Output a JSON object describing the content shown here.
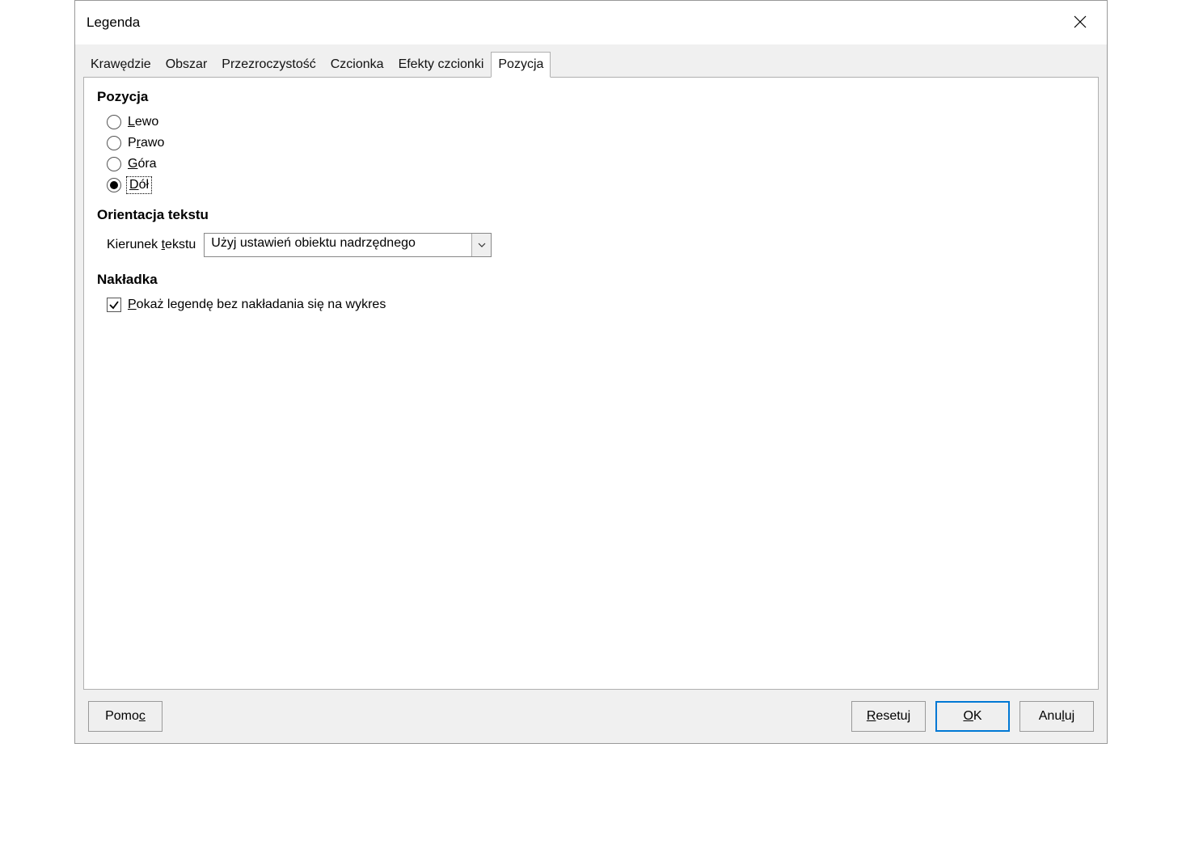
{
  "dialog": {
    "title": "Legenda"
  },
  "tabs": [
    {
      "label": "Krawędzie",
      "active": false
    },
    {
      "label": "Obszar",
      "active": false
    },
    {
      "label": "Przezroczystość",
      "active": false
    },
    {
      "label": "Czcionka",
      "active": false
    },
    {
      "label": "Efekty czcionki",
      "active": false
    },
    {
      "label": "Pozycja",
      "active": true
    }
  ],
  "position": {
    "heading": "Pozycja",
    "options": {
      "left": {
        "pre": "",
        "accel": "L",
        "post": "ewo",
        "checked": false
      },
      "right": {
        "pre": "P",
        "accel": "r",
        "post": "awo",
        "checked": false
      },
      "top": {
        "pre": "",
        "accel": "G",
        "post": "óra",
        "checked": false
      },
      "bottom": {
        "pre": "",
        "accel": "D",
        "post": "ół",
        "checked": true
      }
    }
  },
  "orientation": {
    "heading": "Orientacja tekstu",
    "label_pre": "Kierunek ",
    "label_accel": "t",
    "label_post": "ekstu",
    "value": "Użyj ustawień obiektu nadrzędnego"
  },
  "overlay": {
    "heading": "Nakładka",
    "checkbox": {
      "checked": true,
      "pre": "",
      "accel": "P",
      "post": "okaż legendę bez nakładania się na wykres"
    }
  },
  "buttons": {
    "help": {
      "pre": "Pomo",
      "accel": "c",
      "post": ""
    },
    "reset": {
      "pre": "",
      "accel": "R",
      "post": "esetuj"
    },
    "ok": {
      "pre": "",
      "accel": "O",
      "post": "K"
    },
    "cancel": {
      "pre": "Anu",
      "accel": "l",
      "post": "uj"
    }
  }
}
